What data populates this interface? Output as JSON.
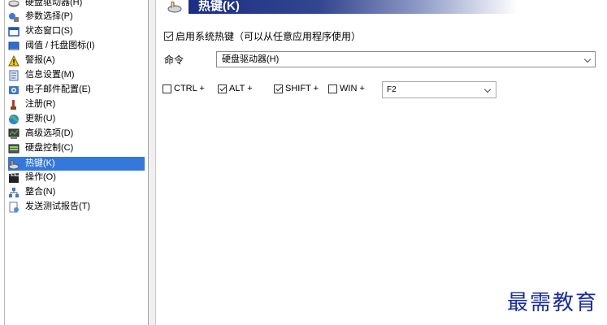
{
  "sidebar": {
    "items": [
      {
        "label": "硬盘驱动器(H)",
        "icon": "hard-drive-icon",
        "selected": false
      },
      {
        "label": "参数选择(P)",
        "icon": "preferences-icon",
        "selected": false
      },
      {
        "label": "状态窗口(S)",
        "icon": "status-window-icon",
        "selected": false
      },
      {
        "label": "阈值 / 托盘图标(I)",
        "icon": "tray-icon",
        "selected": false
      },
      {
        "label": "警报(A)",
        "icon": "warning-icon",
        "selected": false
      },
      {
        "label": "信息设置(M)",
        "icon": "info-settings-icon",
        "selected": false
      },
      {
        "label": "电子邮件配置(E)",
        "icon": "email-icon",
        "selected": false
      },
      {
        "label": "注册(R)",
        "icon": "register-icon",
        "selected": false
      },
      {
        "label": "更新(U)",
        "icon": "update-globe-icon",
        "selected": false
      },
      {
        "label": "高级选项(D)",
        "icon": "advanced-icon",
        "selected": false
      },
      {
        "label": "硬盘控制(C)",
        "icon": "disk-control-icon",
        "selected": false
      },
      {
        "label": "热键(K)",
        "icon": "hotkey-hand-icon",
        "selected": true
      },
      {
        "label": "操作(O)",
        "icon": "actions-clapper-icon",
        "selected": false
      },
      {
        "label": "整合(N)",
        "icon": "integration-icon",
        "selected": false
      },
      {
        "label": "发送测试报告(T)",
        "icon": "send-report-icon",
        "selected": false
      }
    ]
  },
  "panel": {
    "title": "热键(K)",
    "title_icon": "hotkey-hand-icon",
    "enable_label": "启用系统热键（可以从任意应用程序使用）",
    "enable_checked": true,
    "command_label": "命令",
    "command_value": "硬盘驱动器(H)",
    "modifiers": [
      {
        "label": "CTRL +",
        "checked": false
      },
      {
        "label": "ALT +",
        "checked": true
      },
      {
        "label": "SHIFT +",
        "checked": true
      },
      {
        "label": "WIN +",
        "checked": false
      }
    ],
    "key_value": "F2"
  },
  "watermark": "最需教育",
  "colors": {
    "selection": "#3478dc",
    "header_start": "#1c2d84",
    "watermark": "#1a2ca0"
  }
}
